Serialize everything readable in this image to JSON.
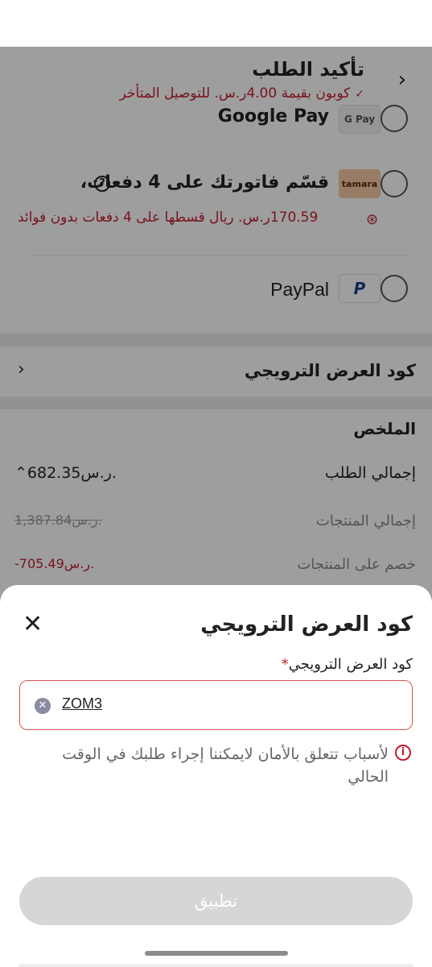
{
  "header": {
    "title": "تأكيد الطلب",
    "coupon_note": "كوبون بقيمة 4.00ر.س. للتوصيل المتأخر"
  },
  "payment_methods": {
    "google_pay": {
      "label": "Google Pay",
      "logo": "G Pay"
    },
    "tamara": {
      "label": "قسّم فاتورتك على 4 دفعات،",
      "logo": "tamara",
      "installment": "170.59ر.س. ريال قسطها على 4 دفعات بدون فوائد"
    },
    "paypal": {
      "label": "PayPal",
      "logo": "P"
    }
  },
  "promo_row": {
    "label": "كود العرض الترويجي"
  },
  "summary": {
    "title": "الملخص",
    "order_total_label": "إجمالي الطلب",
    "order_total_value": "682.35ر.س.",
    "products_total_label": "إجمالي المنتجات",
    "products_total_value": "1,387.84ر.س.",
    "discount_label": "خصم على المنتجات",
    "discount_value": "-705.49ر.س."
  },
  "sheet": {
    "title": "كود العرض الترويجي",
    "field_label": "كود العرض الترويجي",
    "required_mark": "*",
    "input_value": "ZOM3",
    "error_message": "لأسباب تتعلق بالأمان لايمكننا إجراء طلبك في الوقت الحالي",
    "apply_label": "تطبيق"
  },
  "colors": {
    "accent_red": "#c01f2e",
    "disabled_button": "#d6d6d6",
    "overlay": "rgba(0,0,0,0.38)"
  }
}
